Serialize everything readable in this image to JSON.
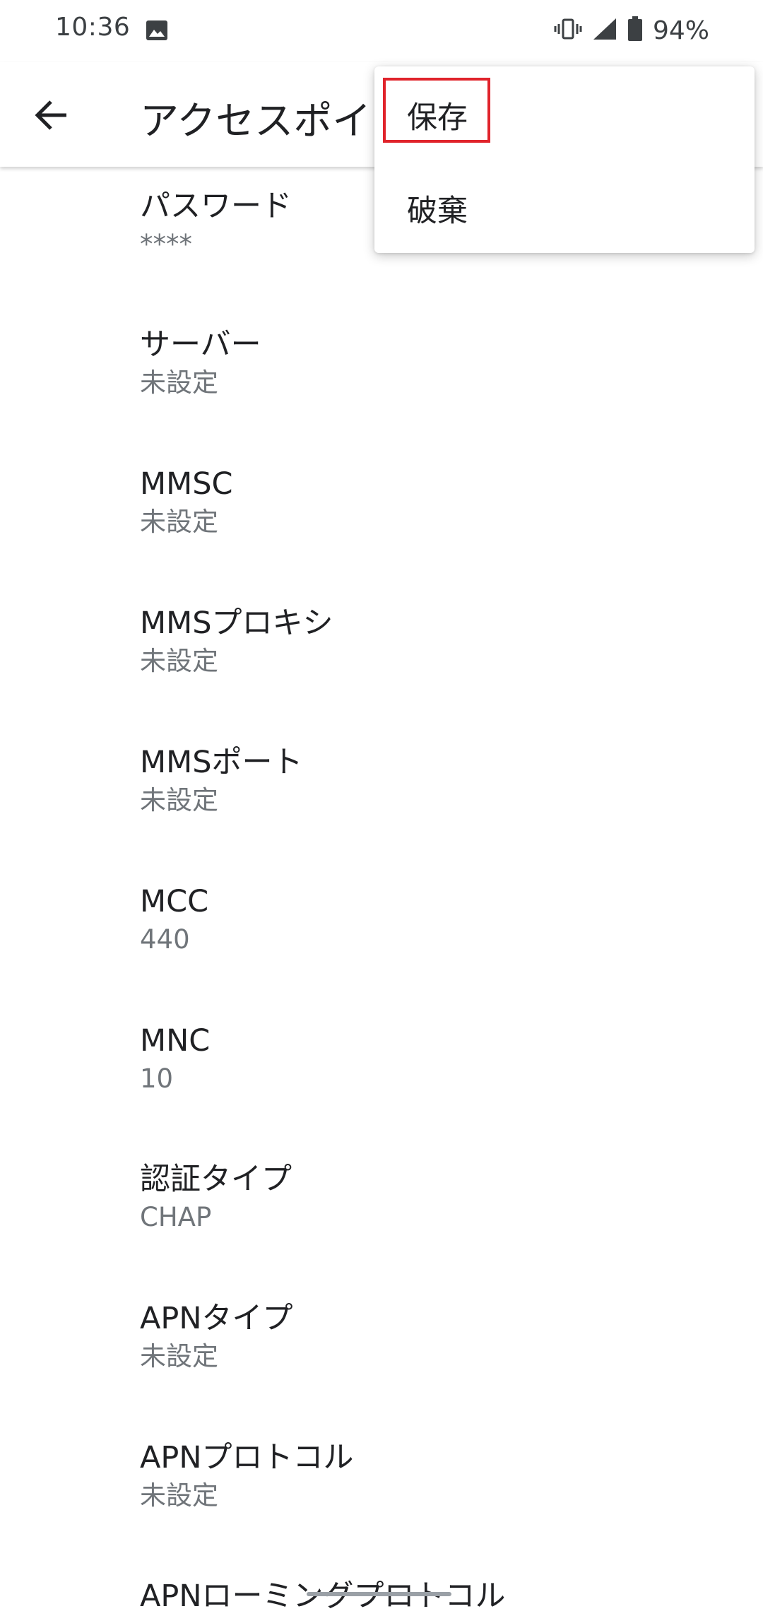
{
  "status_bar": {
    "time": "10:36",
    "battery_percent": "94%",
    "icons": [
      "gallery-icon",
      "vibrate-icon",
      "cellular-signal-icon",
      "battery-icon"
    ]
  },
  "app_bar": {
    "title": "アクセスポイ",
    "back_icon": "arrow-back-icon"
  },
  "overflow_menu": {
    "items": [
      {
        "label": "保存",
        "highlighted": true
      },
      {
        "label": "破棄",
        "highlighted": false
      }
    ],
    "highlight_color": "#e0232b"
  },
  "settings": [
    {
      "title": "パスワード",
      "summary": "****"
    },
    {
      "title": "サーバー",
      "summary": "未設定"
    },
    {
      "title": "MMSC",
      "summary": "未設定"
    },
    {
      "title": "MMSプロキシ",
      "summary": "未設定"
    },
    {
      "title": "MMSポート",
      "summary": "未設定"
    },
    {
      "title": "MCC",
      "summary": "440"
    },
    {
      "title": "MNC",
      "summary": "10"
    },
    {
      "title": "認証タイプ",
      "summary": "CHAP"
    },
    {
      "title": "APNタイプ",
      "summary": "未設定"
    },
    {
      "title": "APNプロトコル",
      "summary": "未設定"
    },
    {
      "title": "APNローミングプロトコル",
      "summary": ""
    }
  ]
}
